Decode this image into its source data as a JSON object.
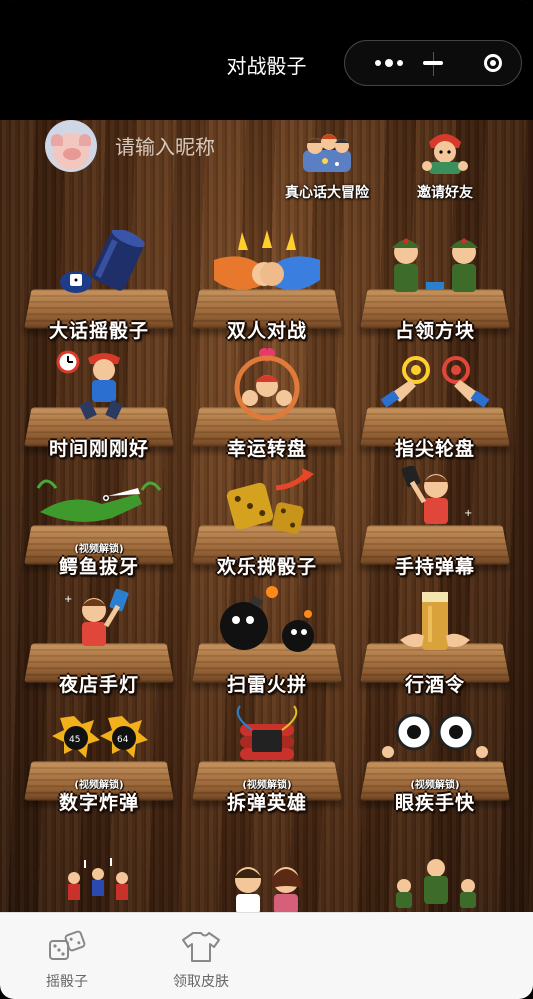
{
  "header": {
    "title": "对战骰子"
  },
  "capsule": {
    "more_icon": "more-dots-icon",
    "minimize_icon": "minimize-icon",
    "close_icon": "target-close-icon"
  },
  "profile": {
    "nickname_placeholder": "请输入昵称",
    "nickname_value": ""
  },
  "shortcuts": [
    {
      "label": "真心话大冒险",
      "icon": "truth-dare-icon"
    },
    {
      "label": "邀请好友",
      "icon": "invite-friend-icon"
    }
  ],
  "games": [
    {
      "label": "大话摇骰子",
      "icon": "dice-cup-icon"
    },
    {
      "label": "双人对战",
      "icon": "fist-bump-icon"
    },
    {
      "label": "占领方块",
      "icon": "soldiers-icon"
    },
    {
      "label": "时间刚刚好",
      "icon": "running-clock-icon"
    },
    {
      "label": "幸运转盘",
      "icon": "wheel-icon"
    },
    {
      "label": "指尖轮盘",
      "icon": "finger-touch-icon"
    },
    {
      "label": "鳄鱼拔牙",
      "icon": "crocodile-icon",
      "badge": "(视频解锁)"
    },
    {
      "label": "欢乐掷骰子",
      "icon": "golden-dice-icon"
    },
    {
      "label": "手持弹幕",
      "icon": "phone-banner-icon"
    },
    {
      "label": "夜店手灯",
      "icon": "nightclub-light-icon"
    },
    {
      "label": "扫雷火拼",
      "icon": "bomb-icon"
    },
    {
      "label": "行酒令",
      "icon": "beer-icon"
    },
    {
      "label": "数字炸弹",
      "icon": "number-bomb-icon",
      "badge": "(视频解锁)"
    },
    {
      "label": "拆弹英雄",
      "icon": "dynamite-icon",
      "badge": "(视频解锁)"
    },
    {
      "label": "眼疾手快",
      "icon": "eyes-icon",
      "badge": "(视频解锁)"
    },
    {
      "label": "",
      "icon": "party-crowd-icon"
    },
    {
      "label": "",
      "icon": "couple-icon"
    },
    {
      "label": "",
      "icon": "soldiers-group-icon"
    }
  ],
  "tabbar": {
    "items": [
      {
        "label": "摇骰子",
        "icon": "dice-icon"
      },
      {
        "label": "领取皮肤",
        "icon": "shirt-icon"
      }
    ]
  }
}
